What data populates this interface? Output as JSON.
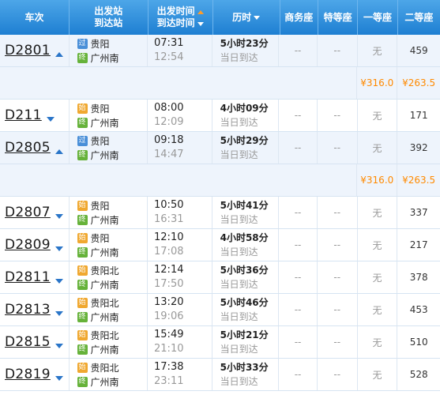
{
  "header": {
    "train": "车次",
    "station_top": "出发站",
    "station_bottom": "到达站",
    "time_top": "出发时间",
    "time_bottom": "到达时间",
    "duration": "历时",
    "business": "商务座",
    "special": "特等座",
    "first": "一等座",
    "second": "二等座"
  },
  "rows": [
    {
      "train": "D2801",
      "arrow": "up",
      "from_badge": "过",
      "from": "贵阳",
      "to_badge": "终",
      "to": "广州南",
      "dep": "07:31",
      "arr": "12:54",
      "dur": "5小时23分",
      "dur_sub": "当日到达",
      "business": "--",
      "special": "--",
      "first": "无",
      "second": "459"
    },
    {
      "train": "D211",
      "arrow": "down",
      "from_badge": "始",
      "from": "贵阳",
      "to_badge": "终",
      "to": "广州南",
      "dep": "08:00",
      "arr": "12:09",
      "dur": "4小时09分",
      "dur_sub": "当日到达",
      "business": "--",
      "special": "--",
      "first": "无",
      "second": "171"
    },
    {
      "train": "D2805",
      "arrow": "up",
      "from_badge": "过",
      "from": "贵阳",
      "to_badge": "终",
      "to": "广州南",
      "dep": "09:18",
      "arr": "14:47",
      "dur": "5小时29分",
      "dur_sub": "当日到达",
      "business": "--",
      "special": "--",
      "first": "无",
      "second": "392"
    },
    {
      "train": "D2807",
      "arrow": "down",
      "from_badge": "始",
      "from": "贵阳",
      "to_badge": "终",
      "to": "广州南",
      "dep": "10:50",
      "arr": "16:31",
      "dur": "5小时41分",
      "dur_sub": "当日到达",
      "business": "--",
      "special": "--",
      "first": "无",
      "second": "337"
    },
    {
      "train": "D2809",
      "arrow": "down",
      "from_badge": "始",
      "from": "贵阳",
      "to_badge": "终",
      "to": "广州南",
      "dep": "12:10",
      "arr": "17:08",
      "dur": "4小时58分",
      "dur_sub": "当日到达",
      "business": "--",
      "special": "--",
      "first": "无",
      "second": "217"
    },
    {
      "train": "D2811",
      "arrow": "down",
      "from_badge": "始",
      "from": "贵阳北",
      "to_badge": "终",
      "to": "广州南",
      "dep": "12:14",
      "arr": "17:50",
      "dur": "5小时36分",
      "dur_sub": "当日到达",
      "business": "--",
      "special": "--",
      "first": "无",
      "second": "378"
    },
    {
      "train": "D2813",
      "arrow": "down",
      "from_badge": "始",
      "from": "贵阳北",
      "to_badge": "终",
      "to": "广州南",
      "dep": "13:20",
      "arr": "19:06",
      "dur": "5小时46分",
      "dur_sub": "当日到达",
      "business": "--",
      "special": "--",
      "first": "无",
      "second": "453"
    },
    {
      "train": "D2815",
      "arrow": "down",
      "from_badge": "始",
      "from": "贵阳北",
      "to_badge": "终",
      "to": "广州南",
      "dep": "15:49",
      "arr": "21:10",
      "dur": "5小时21分",
      "dur_sub": "当日到达",
      "business": "--",
      "special": "--",
      "first": "无",
      "second": "510"
    },
    {
      "train": "D2819",
      "arrow": "down",
      "from_badge": "始",
      "from": "贵阳北",
      "to_badge": "终",
      "to": "广州南",
      "dep": "17:38",
      "arr": "23:11",
      "dur": "5小时33分",
      "dur_sub": "当日到达",
      "business": "--",
      "special": "--",
      "first": "无",
      "second": "528"
    }
  ],
  "price_rows": {
    "after_D2801": {
      "first": "¥316.0",
      "second": "¥263.5"
    },
    "after_D2805": {
      "first": "¥316.0",
      "second": "¥263.5"
    }
  },
  "colors": {
    "header": "#1e7fd2",
    "price": "#ff8a00",
    "row_alt": "#eef4fc"
  }
}
